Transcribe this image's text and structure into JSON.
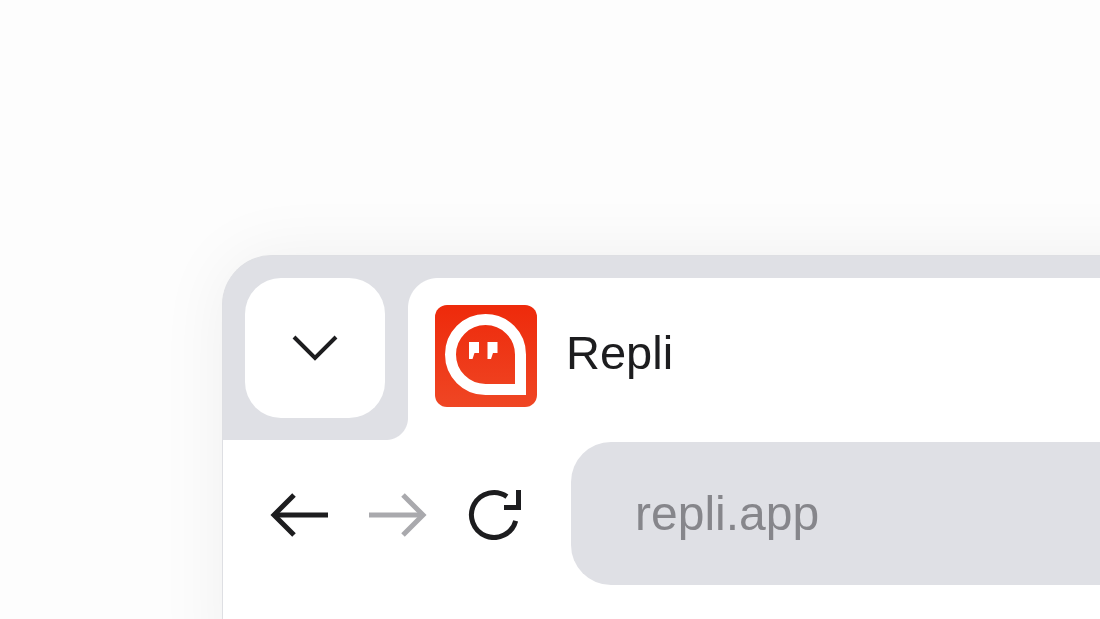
{
  "tabs": [
    {
      "title": "Repli",
      "selected": true
    }
  ],
  "toolbar": {
    "buttons": [
      {
        "kind": "back",
        "disabled": false
      },
      {
        "kind": "forward",
        "disabled": true
      },
      {
        "kind": "reload",
        "disabled": false
      }
    ]
  },
  "address_bar": {
    "value": "repli.app"
  }
}
